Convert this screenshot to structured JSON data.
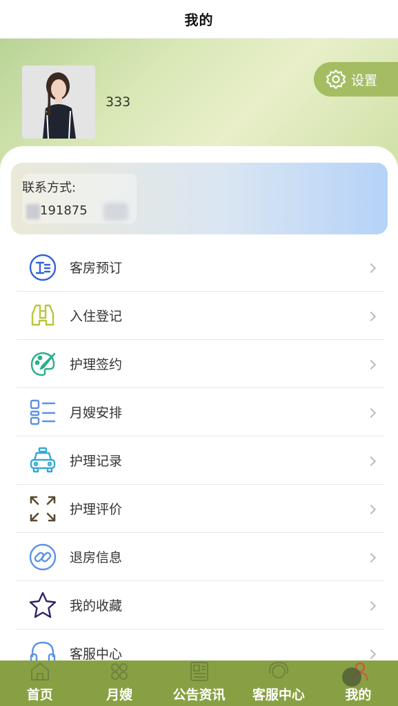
{
  "topbar": {
    "title": "我的"
  },
  "profile": {
    "username": "333"
  },
  "settings": {
    "label": "设置"
  },
  "contact": {
    "label": "联系方式:",
    "value": "191875"
  },
  "menu": [
    {
      "label": "客房预订",
      "icon": "booking-icon",
      "color": "#2f63d6"
    },
    {
      "label": "入住登记",
      "icon": "binoculars-icon",
      "color": "#b8c63a"
    },
    {
      "label": "护理签约",
      "icon": "palette-icon",
      "color": "#2aae8d"
    },
    {
      "label": "月嫂安排",
      "icon": "list-icon",
      "color": "#5e8fe0"
    },
    {
      "label": "护理记录",
      "icon": "taxi-icon",
      "color": "#32a9d6"
    },
    {
      "label": "护理评价",
      "icon": "expand-icon",
      "color": "#5a4a2e"
    },
    {
      "label": "退房信息",
      "icon": "link-icon",
      "color": "#5a92e6"
    },
    {
      "label": "我的收藏",
      "icon": "star-icon",
      "color": "#2b2469"
    },
    {
      "label": "客服中心",
      "icon": "headset-icon",
      "color": "#5a92e6"
    }
  ],
  "tabs": [
    {
      "label": "首页",
      "icon": "home-icon"
    },
    {
      "label": "月嫂",
      "icon": "grid-icon"
    },
    {
      "label": "公告资讯",
      "icon": "news-icon"
    },
    {
      "label": "客服中心",
      "icon": "service-icon"
    },
    {
      "label": "我的",
      "icon": "user-icon",
      "active": true
    }
  ],
  "colors": {
    "accent": "#88a044",
    "settings": "#a4bd62"
  }
}
